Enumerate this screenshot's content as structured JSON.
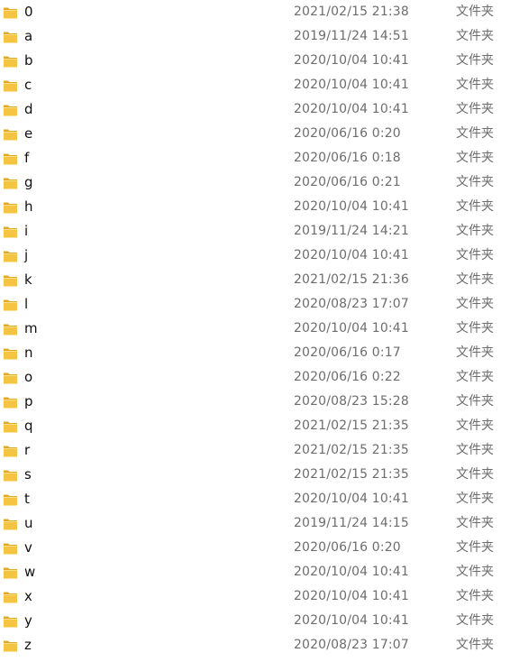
{
  "colors": {
    "folder_front": "#f5c443",
    "folder_back": "#e2a928",
    "date_text": "#6d6d6d",
    "name_text": "#111111"
  },
  "folder_icon": "folder-icon",
  "files": [
    {
      "name": "0",
      "date": "2021/02/15 21:38",
      "type": "文件夹"
    },
    {
      "name": "a",
      "date": "2019/11/24 14:51",
      "type": "文件夹"
    },
    {
      "name": "b",
      "date": "2020/10/04 10:41",
      "type": "文件夹"
    },
    {
      "name": "c",
      "date": "2020/10/04 10:41",
      "type": "文件夹"
    },
    {
      "name": "d",
      "date": "2020/10/04 10:41",
      "type": "文件夹"
    },
    {
      "name": "e",
      "date": "2020/06/16 0:20",
      "type": "文件夹"
    },
    {
      "name": "f",
      "date": "2020/06/16 0:18",
      "type": "文件夹"
    },
    {
      "name": "g",
      "date": "2020/06/16 0:21",
      "type": "文件夹"
    },
    {
      "name": "h",
      "date": "2020/10/04 10:41",
      "type": "文件夹"
    },
    {
      "name": "i",
      "date": "2019/11/24 14:21",
      "type": "文件夹"
    },
    {
      "name": "j",
      "date": "2020/10/04 10:41",
      "type": "文件夹"
    },
    {
      "name": "k",
      "date": "2021/02/15 21:36",
      "type": "文件夹"
    },
    {
      "name": "l",
      "date": "2020/08/23 17:07",
      "type": "文件夹"
    },
    {
      "name": "m",
      "date": "2020/10/04 10:41",
      "type": "文件夹"
    },
    {
      "name": "n",
      "date": "2020/06/16 0:17",
      "type": "文件夹"
    },
    {
      "name": "o",
      "date": "2020/06/16 0:22",
      "type": "文件夹"
    },
    {
      "name": "p",
      "date": "2020/08/23 15:28",
      "type": "文件夹"
    },
    {
      "name": "q",
      "date": "2021/02/15 21:35",
      "type": "文件夹"
    },
    {
      "name": "r",
      "date": "2021/02/15 21:35",
      "type": "文件夹"
    },
    {
      "name": "s",
      "date": "2021/02/15 21:35",
      "type": "文件夹"
    },
    {
      "name": "t",
      "date": "2020/10/04 10:41",
      "type": "文件夹"
    },
    {
      "name": "u",
      "date": "2019/11/24 14:15",
      "type": "文件夹"
    },
    {
      "name": "v",
      "date": "2020/06/16 0:20",
      "type": "文件夹"
    },
    {
      "name": "w",
      "date": "2020/10/04 10:41",
      "type": "文件夹"
    },
    {
      "name": "x",
      "date": "2020/10/04 10:41",
      "type": "文件夹"
    },
    {
      "name": "y",
      "date": "2020/10/04 10:41",
      "type": "文件夹"
    },
    {
      "name": "z",
      "date": "2020/08/23 17:07",
      "type": "文件夹"
    }
  ]
}
